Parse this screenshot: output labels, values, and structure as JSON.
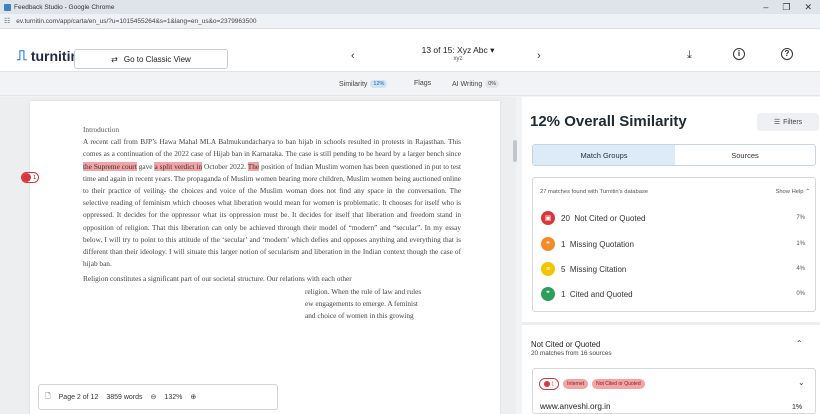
{
  "window": {
    "title": "Feedback Studio - Google Chrome",
    "url": "ev.turnitin.com/app/carta/en_us/?u=1015455264&s=1&lang=en_us&o=2379963500",
    "controls": [
      "–",
      "❐",
      "✕"
    ]
  },
  "header": {
    "logo": "turnitin",
    "classic_btn": "Go to Classic View",
    "nav_title": "13 of 15: Xyz Abc",
    "nav_sub": "xyz"
  },
  "tabs": [
    {
      "label": "Similarity",
      "badge": "12%"
    },
    {
      "label": "Flags",
      "badge": ""
    },
    {
      "label": "AI Writing",
      "badge": "0%"
    }
  ],
  "doc": {
    "heading": "Introduction",
    "p1_a": "A recent call from BJP’s Hawa Mahal MLA Balmukundacharya to ban hijab in schools resulted in protests in Rajasthan. This comes as a continuation of the 2022 case of Hijab ban in Karnataka. The case is still pending to be heard by a larger bench since ",
    "p1_hl1": "the Supreme court",
    "p1_b": " gave ",
    "p1_hl2": "a split verdict in",
    "p1_c": " October 2022. ",
    "p1_hl3": "The",
    "p1_d": " position of Indian Muslim women has been questioned in put to test time and again in recent years. The propaganda of Muslim women bearing more children, Muslim women being auctioned online to their practice of veiling- the choices and voice of the Muslim woman does not find any space in the conversation. The selective reading of feminism which chooses what liberation would mean for women is problematic. It chooses for itself who is oppressed. It decides for the oppressor what its oppression must be. It decides for itself that liberation and freedom stand in opposition of religion. That this liberation can only be achieved through their model of “modern” and “secular”. In my essay below, I will try to point to this attitude of the ‘secular’ and ‘modern’ which defies and opposes anything and everything that is different than their ideology. I will situate this larger notion of secularism and liberation in the Indian context though the case of hijab ban.",
    "p2_a": "Religion constitutes a significant part of our societal structure. Our relations with each other",
    "p2_b": "religion. When the rule of law and rules",
    "p2_c": "ew engagements to emerge. A feminist",
    "p2_d": "and choice of women in this growing",
    "marker_num": "1"
  },
  "footer": {
    "page": "Page 2 of 12",
    "words": "3859 words",
    "zoom": "132%"
  },
  "panel": {
    "title": "12% Overall Similarity",
    "filters": "Filters",
    "seg": [
      "Match Groups",
      "Sources"
    ],
    "box_head": "27 matches found with Turnitin's database",
    "show_help": "Show Help",
    "rows": [
      {
        "count": "20",
        "label": "Not Cited or Quoted",
        "pct": "7%",
        "color": "#d9363e",
        "icon": "▣"
      },
      {
        "count": "1",
        "label": "Missing Quotation",
        "pct": "1%",
        "color": "#f28c28",
        "icon": "❝"
      },
      {
        "count": "5",
        "label": "Missing Citation",
        "pct": "4%",
        "color": "#f5c400",
        "icon": "≡"
      },
      {
        "count": "1",
        "label": "Cited and Quoted",
        "pct": "0%",
        "color": "#2e9e5b",
        "icon": "❞"
      }
    ],
    "section_title": "Not Cited or Quoted",
    "section_sub": "20 matches from 16 sources",
    "item": {
      "num": "1",
      "pill1": "Internet",
      "pill2": "Not Cited or Quoted",
      "url": "www.anveshi.org.in",
      "pct": "1%"
    }
  }
}
